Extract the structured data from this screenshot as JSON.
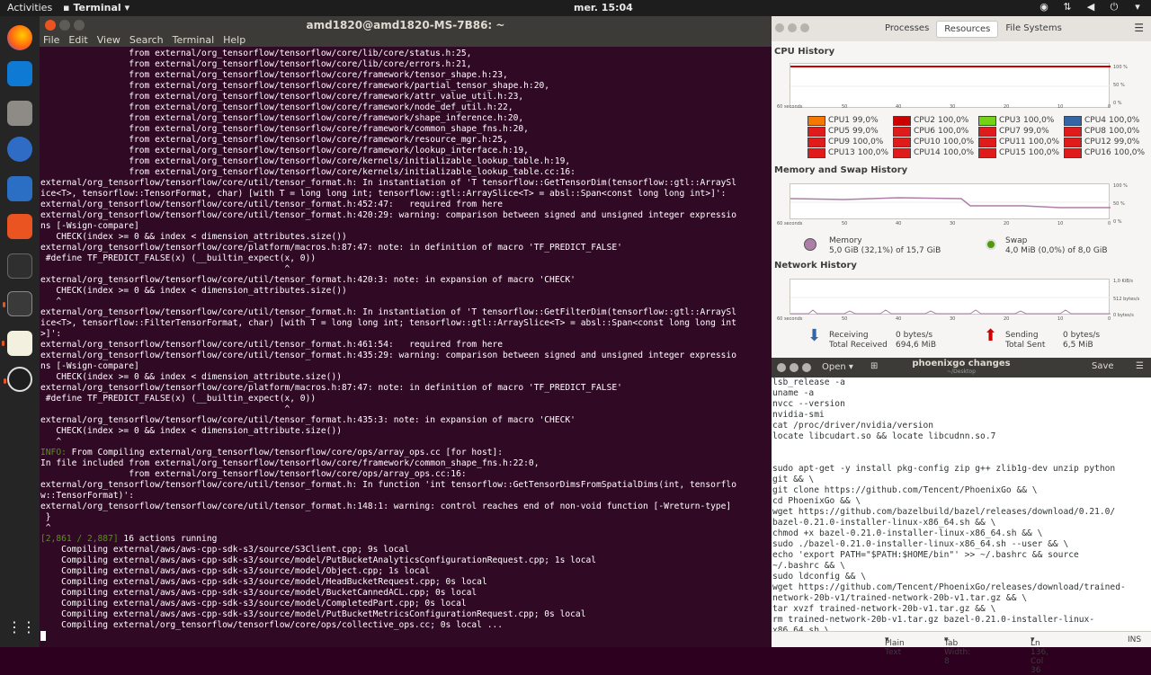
{
  "topbar": {
    "activities": "Activities",
    "app_name": "Terminal",
    "clock": "mer. 15:04"
  },
  "dock": {
    "icons": [
      "firefox-icon",
      "vscode-icon",
      "files-icon",
      "thunderbird-icon",
      "libreoffice-writer-icon",
      "software-center-icon",
      "system-monitor-icon",
      "terminal-icon",
      "text-editor-icon",
      "obs-icon",
      "show-apps-icon"
    ]
  },
  "terminal": {
    "title": "amd1820@amd1820-MS-7B86: ~",
    "menu": [
      "File",
      "Edit",
      "View",
      "Search",
      "Terminal",
      "Help"
    ],
    "lines": [
      "                 from external/org_tensorflow/tensorflow/core/lib/core/status.h:25,",
      "                 from external/org_tensorflow/tensorflow/core/lib/core/errors.h:21,",
      "                 from external/org_tensorflow/tensorflow/core/framework/tensor_shape.h:23,",
      "                 from external/org_tensorflow/tensorflow/core/framework/partial_tensor_shape.h:20,",
      "                 from external/org_tensorflow/tensorflow/core/framework/attr_value_util.h:23,",
      "                 from external/org_tensorflow/tensorflow/core/framework/node_def_util.h:22,",
      "                 from external/org_tensorflow/tensorflow/core/framework/shape_inference.h:20,",
      "                 from external/org_tensorflow/tensorflow/core/framework/common_shape_fns.h:20,",
      "                 from external/org_tensorflow/tensorflow/core/framework/resource_mgr.h:25,",
      "                 from external/org_tensorflow/tensorflow/core/framework/lookup_interface.h:19,",
      "                 from external/org_tensorflow/tensorflow/core/kernels/initializable_lookup_table.h:19,",
      "                 from external/org_tensorflow/tensorflow/core/kernels/initializable_lookup_table.cc:16:",
      "external/org_tensorflow/tensorflow/core/util/tensor_format.h: In instantiation of 'T tensorflow::GetTensorDim(tensorflow::gtl::ArraySl",
      "ice<T>, tensorflow::TensorFormat, char) [with T = long long int; tensorflow::gtl::ArraySlice<T> = absl::Span<const long long int>]':",
      "external/org_tensorflow/tensorflow/core/util/tensor_format.h:452:47:   required from here",
      "external/org_tensorflow/tensorflow/core/util/tensor_format.h:420:29: warning: comparison between signed and unsigned integer expressio",
      "ns [-Wsign-compare]",
      "   CHECK(index >= 0 && index < dimension_attributes.size())",
      "external/org_tensorflow/tensorflow/core/platform/macros.h:87:47: note: in definition of macro 'TF_PREDICT_FALSE'",
      " #define TF_PREDICT_FALSE(x) (__builtin_expect(x, 0))",
      "                                               ^",
      "external/org_tensorflow/tensorflow/core/util/tensor_format.h:420:3: note: in expansion of macro 'CHECK'",
      "   CHECK(index >= 0 && index < dimension_attributes.size())",
      "   ^",
      "external/org_tensorflow/tensorflow/core/util/tensor_format.h: In instantiation of 'T tensorflow::GetFilterDim(tensorflow::gtl::ArraySl",
      "ice<T>, tensorflow::FilterTensorFormat, char) [with T = long long int; tensorflow::gtl::ArraySlice<T> = absl::Span<const long long int",
      ">]':",
      "external/org_tensorflow/tensorflow/core/util/tensor_format.h:461:54:   required from here",
      "external/org_tensorflow/tensorflow/core/util/tensor_format.h:435:29: warning: comparison between signed and unsigned integer expressio",
      "ns [-Wsign-compare]",
      "   CHECK(index >= 0 && index < dimension_attribute.size())",
      "external/org_tensorflow/tensorflow/core/platform/macros.h:87:47: note: in definition of macro 'TF_PREDICT_FALSE'",
      " #define TF_PREDICT_FALSE(x) (__builtin_expect(x, 0))",
      "                                               ^",
      "external/org_tensorflow/tensorflow/core/util/tensor_format.h:435:3: note: in expansion of macro 'CHECK'",
      "   CHECK(index >= 0 && index < dimension_attribute.size())",
      "   ^"
    ],
    "info_prefix": "INFO:",
    "info_text": " From Compiling external/org_tensorflow/tensorflow/core/ops/array_ops.cc [for host]:",
    "lines2": [
      "In file included from external/org_tensorflow/tensorflow/core/framework/common_shape_fns.h:22:0,",
      "                 from external/org_tensorflow/tensorflow/core/ops/array_ops.cc:16:",
      "external/org_tensorflow/tensorflow/core/util/tensor_format.h: In function 'int tensorflow::GetTensorDimsFromSpatialDims(int, tensorflo",
      "w::TensorFormat)':",
      "external/org_tensorflow/tensorflow/core/util/tensor_format.h:148:1: warning: control reaches end of non-void function [-Wreturn-type]",
      " }",
      " ^"
    ],
    "progress_prefix": "[2,861 / 2,887]",
    "progress_text": " 16 actions running",
    "compile_lines": [
      "    Compiling external/aws/aws-cpp-sdk-s3/source/S3Client.cpp; 9s local",
      "    Compiling external/aws/aws-cpp-sdk-s3/source/model/PutBucketAnalyticsConfigurationRequest.cpp; 1s local",
      "    Compiling external/aws/aws-cpp-sdk-s3/source/model/Object.cpp; 1s local",
      "    Compiling external/aws/aws-cpp-sdk-s3/source/model/HeadBucketRequest.cpp; 0s local",
      "    Compiling external/aws/aws-cpp-sdk-s3/source/model/BucketCannedACL.cpp; 0s local",
      "    Compiling external/aws/aws-cpp-sdk-s3/source/model/CompletedPart.cpp; 0s local",
      "    Compiling external/aws/aws-cpp-sdk-s3/source/model/PutBucketMetricsConfigurationRequest.cpp; 0s local",
      "    Compiling external/org_tensorflow/tensorflow/core/ops/collective_ops.cc; 0s local ..."
    ]
  },
  "sysmon": {
    "tabs": [
      "Processes",
      "Resources",
      "File Systems"
    ],
    "selected_tab": "Resources",
    "cpu_title": "CPU History",
    "mem_title": "Memory and Swap History",
    "net_title": "Network History",
    "x_ticks": [
      "60 seconds",
      "50",
      "40",
      "30",
      "20",
      "10",
      "0"
    ],
    "pct_ticks": [
      "100 %",
      "50 %",
      "0 %"
    ],
    "net_ticks": [
      "1,0 KiB/s",
      "512 bytes/s",
      "0 bytes/s"
    ],
    "cpus": [
      {
        "label": "CPU1",
        "value": "99,0%",
        "color": "#f57900"
      },
      {
        "label": "CPU2",
        "value": "100,0%",
        "color": "#cc0000"
      },
      {
        "label": "CPU3",
        "value": "100,0%",
        "color": "#73d216"
      },
      {
        "label": "CPU4",
        "value": "100,0%",
        "color": "#3465a4"
      },
      {
        "label": "CPU5",
        "value": "99,0%",
        "color": "#e01b1b"
      },
      {
        "label": "CPU6",
        "value": "100,0%",
        "color": "#e01b1b"
      },
      {
        "label": "CPU7",
        "value": "99,0%",
        "color": "#e01b1b"
      },
      {
        "label": "CPU8",
        "value": "100,0%",
        "color": "#e01b1b"
      },
      {
        "label": "CPU9",
        "value": "100,0%",
        "color": "#e01b1b"
      },
      {
        "label": "CPU10",
        "value": "100,0%",
        "color": "#e01b1b"
      },
      {
        "label": "CPU11",
        "value": "100,0%",
        "color": "#e01b1b"
      },
      {
        "label": "CPU12",
        "value": "99,0%",
        "color": "#e01b1b"
      },
      {
        "label": "CPU13",
        "value": "100,0%",
        "color": "#e01b1b"
      },
      {
        "label": "CPU14",
        "value": "100,0%",
        "color": "#e01b1b"
      },
      {
        "label": "CPU15",
        "value": "100,0%",
        "color": "#e01b1b"
      },
      {
        "label": "CPU16",
        "value": "100,0%",
        "color": "#e01b1b"
      }
    ],
    "memory_label": "Memory",
    "memory_value": "5,0 GiB (32,1%) of 15,7 GiB",
    "swap_label": "Swap",
    "swap_value": "4,0 MiB (0,0%) of 8,0 GiB",
    "receiving_label": "Receiving",
    "receiving_value": "0 bytes/s",
    "total_received_label": "Total Received",
    "total_received_value": "694,6 MiB",
    "sending_label": "Sending",
    "sending_value": "0 bytes/s",
    "total_sent_label": "Total Sent",
    "total_sent_value": "6,5 MiB"
  },
  "gedit": {
    "open_label": "Open",
    "title": "phoenixgo changes",
    "subtitle": "~/Desktop",
    "save_label": "Save",
    "lines": [
      "lsb_release -a",
      "uname -a",
      "nvcc --version",
      "nvidia-smi",
      "cat /proc/driver/nvidia/version",
      "locate libcudart.so && locate libcudnn.so.7",
      "",
      "",
      "sudo apt-get -y install pkg-config zip g++ zlib1g-dev unzip python",
      "git && \\",
      "git clone https://github.com/Tencent/PhoenixGo && \\",
      "cd PhoenixGo && \\",
      "wget https://github.com/bazelbuild/bazel/releases/download/0.21.0/",
      "bazel-0.21.0-installer-linux-x86_64.sh && \\",
      "chmod +x bazel-0.21.0-installer-linux-x86_64.sh && \\",
      "sudo ./bazel-0.21.0-installer-linux-x86_64.sh --user && \\",
      "echo 'export PATH=\"$PATH:$HOME/bin\"' >> ~/.bashrc && source",
      "~/.bashrc && \\",
      "sudo ldconfig && \\",
      "wget https://github.com/Tencent/PhoenixGo/releases/download/trained-",
      "network-20b-v1/trained-network-20b-v1.tar.gz && \\",
      "tar xvzf trained-network-20b-v1.tar.gz && \\",
      "rm trained-network-20b-v1.tar.gz bazel-0.21.0-installer-linux-",
      "x86_64.sh \\"
    ],
    "status_plain": "Plain Text",
    "status_tab": "Tab Width: 8",
    "status_pos": "Ln 136, Col 36",
    "status_ins": "INS"
  }
}
